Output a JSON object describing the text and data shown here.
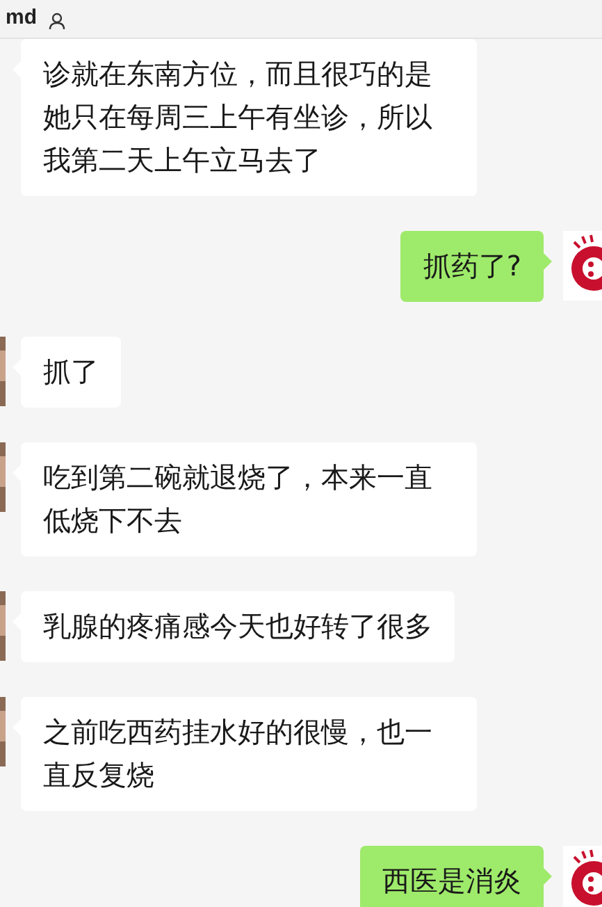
{
  "header": {
    "title": "md"
  },
  "messages": [
    {
      "kind": "received",
      "text": "诊就在东南方位，而且很巧的是她只在每周三上午有坐诊，所以我第二天上午立马去了",
      "avatar": false
    },
    {
      "kind": "sent",
      "text": "抓药了?",
      "avatar": true
    },
    {
      "kind": "received",
      "text": "抓了",
      "avatar": true
    },
    {
      "kind": "received",
      "text": "吃到第二碗就退烧了，本来一直低烧下不去",
      "avatar": true
    },
    {
      "kind": "received",
      "text": "乳腺的疼痛感今天也好转了很多",
      "avatar": true
    },
    {
      "kind": "received",
      "text": "之前吃西药挂水好的很慢，也一直反复烧",
      "avatar": true
    },
    {
      "kind": "sent",
      "text": "西医是消炎",
      "avatar": true
    }
  ]
}
